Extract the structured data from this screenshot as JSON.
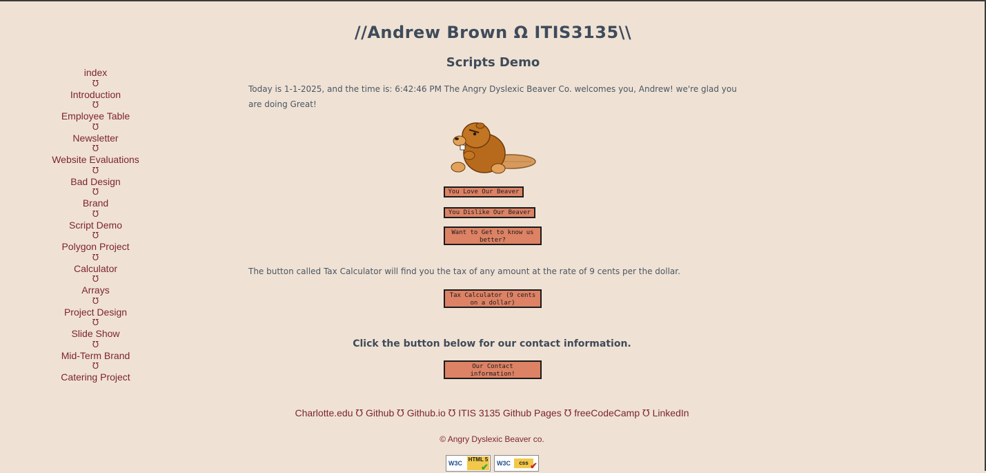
{
  "header": {
    "site_title": "//Andrew Brown Ω ITIS3135\\\\",
    "page_title": "Scripts Demo"
  },
  "nav": {
    "separator": "℧",
    "items": [
      {
        "label": "index"
      },
      {
        "label": "Introduction"
      },
      {
        "label": "Employee Table"
      },
      {
        "label": "Newsletter"
      },
      {
        "label": "Website Evaluations"
      },
      {
        "label": "Bad Design"
      },
      {
        "label": "Brand"
      },
      {
        "label": "Script Demo"
      },
      {
        "label": "Polygon Project"
      },
      {
        "label": "Calculator"
      },
      {
        "label": "Arrays"
      },
      {
        "label": "Project Design"
      },
      {
        "label": "Slide Show"
      },
      {
        "label": "Mid-Term Brand"
      },
      {
        "label": "Catering Project"
      }
    ]
  },
  "main": {
    "intro_text": "Today is 1-1-2025, and the time is: 6:42:46 PM The Angry Dyslexic Beaver Co. welcomes you, Andrew! we're glad you are doing Great!",
    "beaver_image": "angry-beaver-cartoon",
    "buttons": {
      "love": "You Love Our Beaver",
      "dislike": "You Dislike Our Beaver",
      "know": "Want to Get to know us better?"
    },
    "tax_description": "The button called Tax Calculator will find you the tax of any amount at the rate of 9 cents per the dollar.",
    "tax_button": "Tax Calculator (9 cents on a dollar)",
    "contact_prompt": "Click the button below for our contact information.",
    "contact_button": "Our Contact information!"
  },
  "footer": {
    "separator": "℧",
    "links": [
      "Charlotte.edu",
      "Github",
      "Github.io",
      "ITIS 3135 Github Pages",
      "freeCodeCamp",
      "LinkedIn"
    ],
    "copyright": "© Angry Dyslexic Beaver co.",
    "badges": {
      "html": {
        "w3c": "W3C",
        "label": "HTML 5"
      },
      "css": {
        "w3c": "W3C",
        "label": "css"
      }
    }
  },
  "colors": {
    "background": "#efe2d4",
    "link": "#7d2330",
    "heading": "#3f4b5a",
    "button": "#dd8265"
  }
}
